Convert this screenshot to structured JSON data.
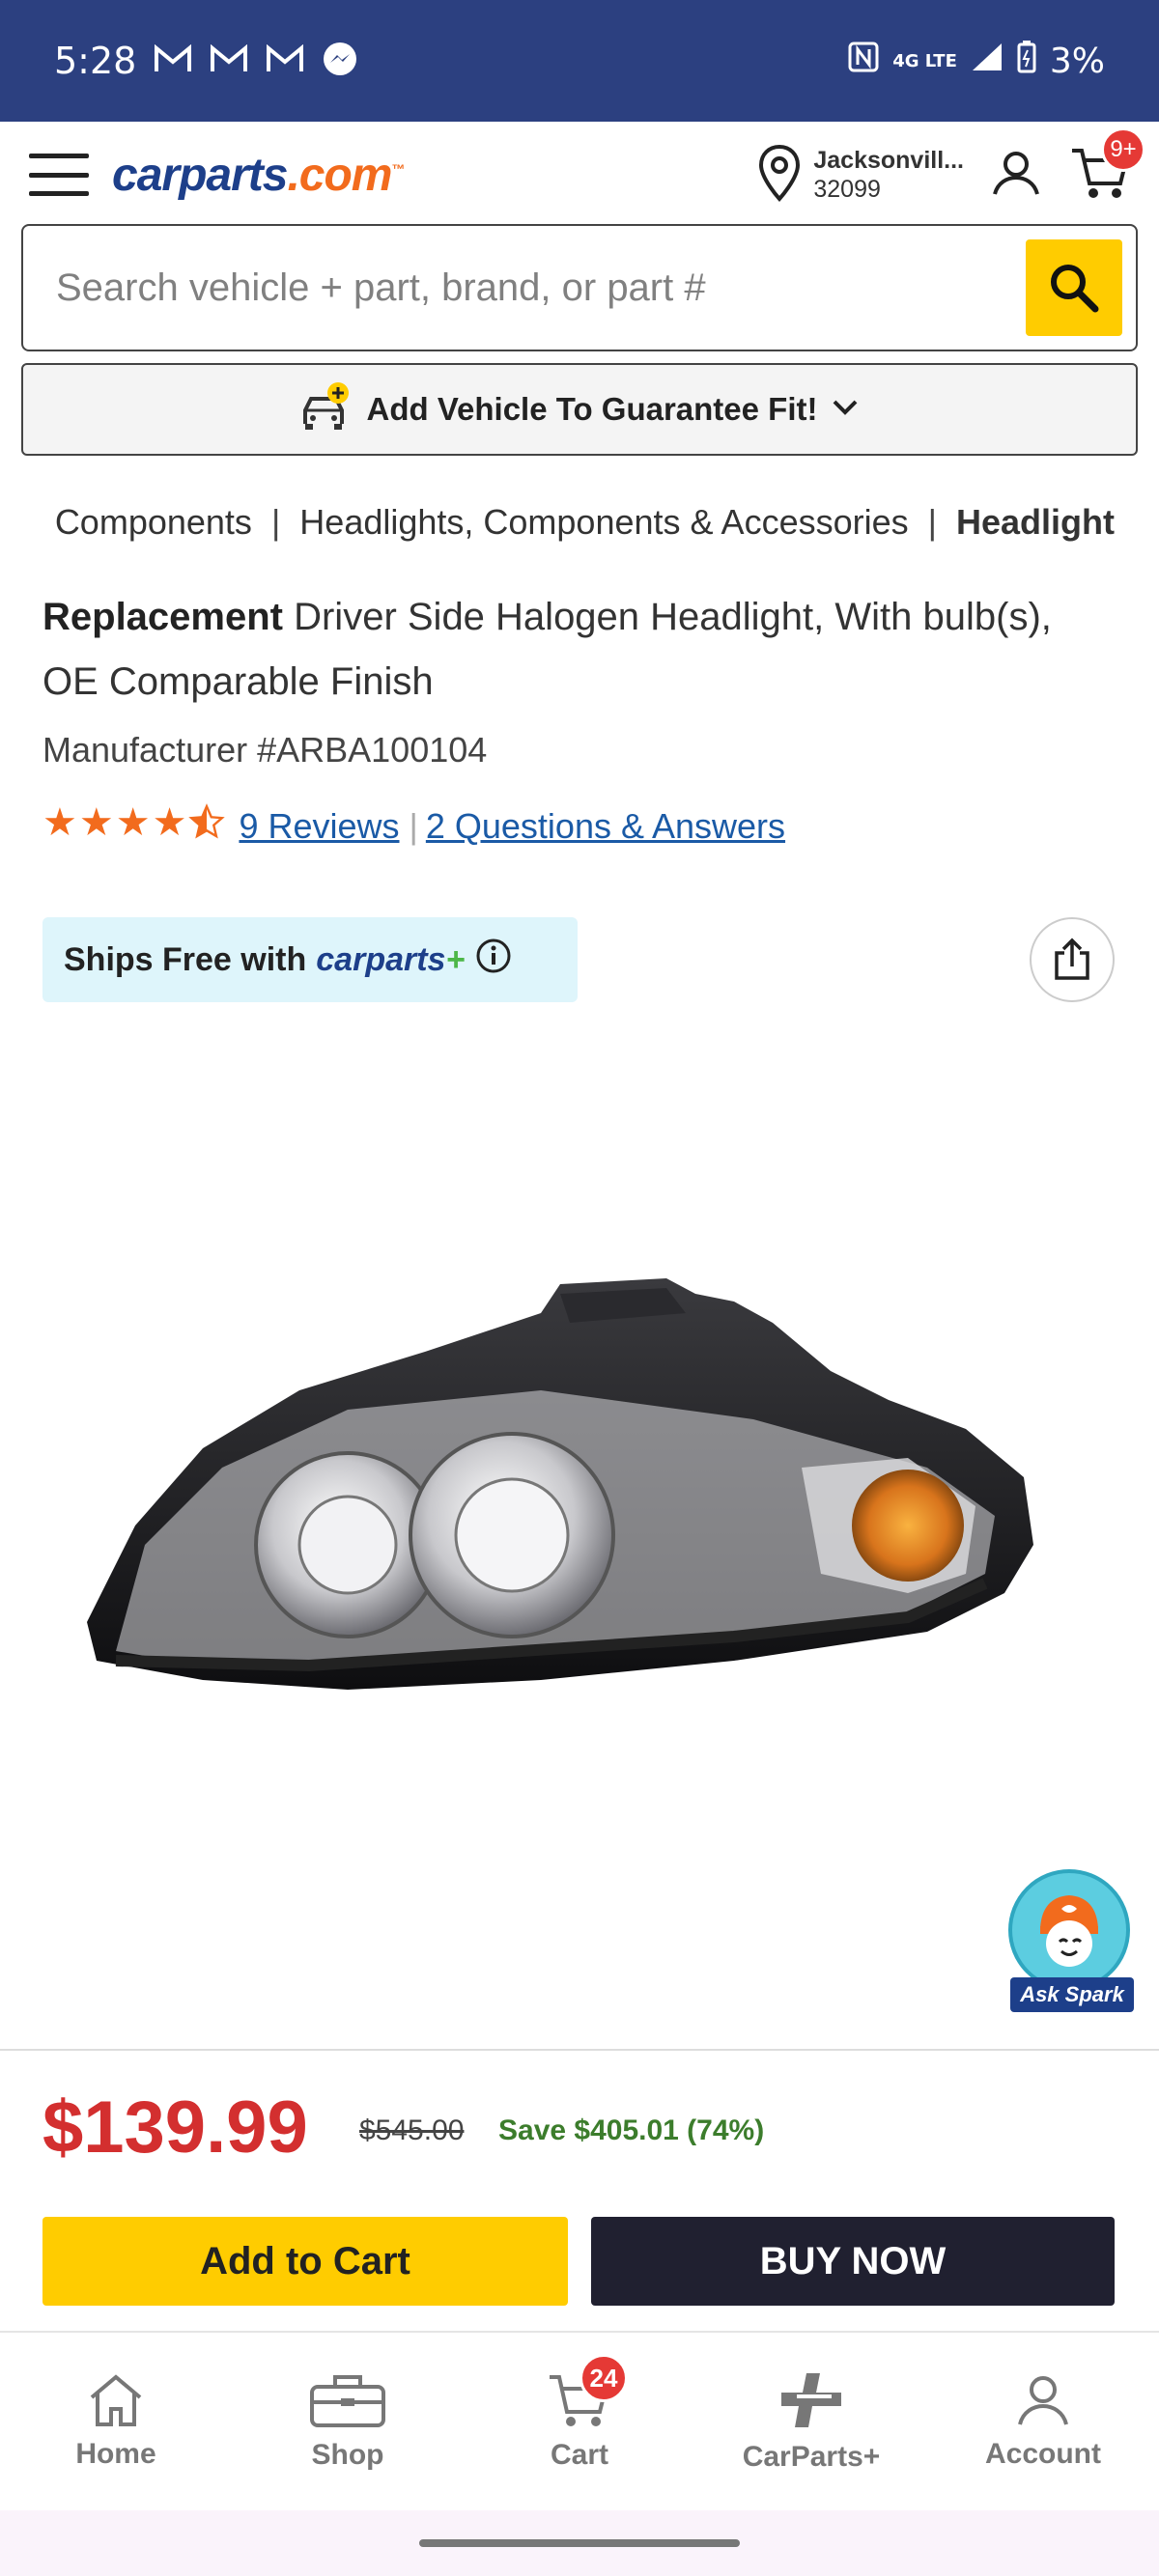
{
  "status_bar": {
    "time": "5:28",
    "battery": "3%",
    "network": "4G LTE"
  },
  "header": {
    "logo_main": "carparts",
    "logo_tld": ".com",
    "logo_tm": "™",
    "location_city": "Jacksonvill...",
    "location_zip": "32099",
    "cart_badge": "9+"
  },
  "search": {
    "placeholder": "Search vehicle + part, brand, or part #"
  },
  "add_vehicle": {
    "label": "Add Vehicle To Guarantee Fit!"
  },
  "breadcrumb": {
    "items": [
      "Components",
      "Headlights, Components & Accessories"
    ],
    "current": "Headlight"
  },
  "product": {
    "title_bold": "Replacement",
    "title_rest": " Driver Side Halogen Headlight, With bulb(s), OE Comparable Finish",
    "manufacturer": "Manufacturer #ARBA100104",
    "rating": 4.5,
    "reviews_link": "9 Reviews",
    "qa_link": "2 Questions & Answers",
    "ships_free_text": "Ships Free with",
    "ships_brand": "carparts",
    "ships_plus": "+"
  },
  "spark": {
    "label": "Ask Spark"
  },
  "pricing": {
    "price": "$139.99",
    "was_price": "$545.00",
    "savings": "Save $405.01 (74%)"
  },
  "actions": {
    "add_to_cart": "Add to Cart",
    "buy_now": "BUY NOW"
  },
  "bottom_nav": {
    "home": "Home",
    "shop": "Shop",
    "cart": "Cart",
    "cart_badge": "24",
    "carparts_plus": "CarParts+",
    "account": "Account"
  },
  "colors": {
    "status_bar": "#2c4080",
    "brand_blue": "#1d3f8a",
    "brand_orange": "#f26b1d",
    "cta_yellow": "#ffcc00",
    "price_red": "#d32f2f",
    "save_green": "#3c7d2c"
  }
}
